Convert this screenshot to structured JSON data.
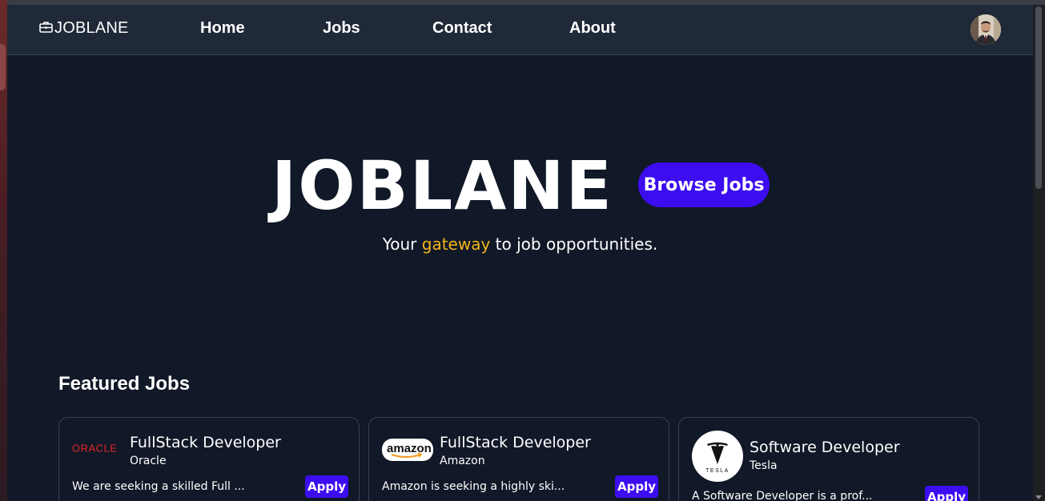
{
  "navbar": {
    "brand": "JOBLANE",
    "links": [
      {
        "label": "Home"
      },
      {
        "label": "Jobs"
      },
      {
        "label": "Contact"
      },
      {
        "label": "About"
      }
    ]
  },
  "hero": {
    "title": "JOBLANE",
    "browse_label": "Browse Jobs",
    "tagline_before": "Your ",
    "tagline_accent": "gateway",
    "tagline_after": " to job opportunities."
  },
  "featured": {
    "heading": "Featured Jobs",
    "jobs": [
      {
        "title": "FullStack Developer",
        "company": "Oracle",
        "logo_text": "ORACLE",
        "description": "We are seeking a skilled Full ...",
        "apply_label": "Apply"
      },
      {
        "title": "FullStack Developer",
        "company": "Amazon",
        "logo_text": "amazon",
        "description": "Amazon is seeking a highly ski...",
        "apply_label": "Apply"
      },
      {
        "title": "Software Developer",
        "company": "Tesla",
        "logo_text": "TESLA",
        "description": "A Software Developer is a prof...",
        "apply_label": "Apply"
      }
    ]
  },
  "colors": {
    "page_bg": "#111827",
    "navbar_bg": "#1f2937",
    "primary_button": "#3c0df0",
    "accent_text": "#f0b51b",
    "oracle_red": "#e3262b"
  },
  "icons": {
    "brand": "briefcase-icon",
    "avatar": "user-avatar",
    "oracle": "oracle-logo",
    "amazon": "amazon-logo",
    "tesla": "tesla-logo"
  }
}
